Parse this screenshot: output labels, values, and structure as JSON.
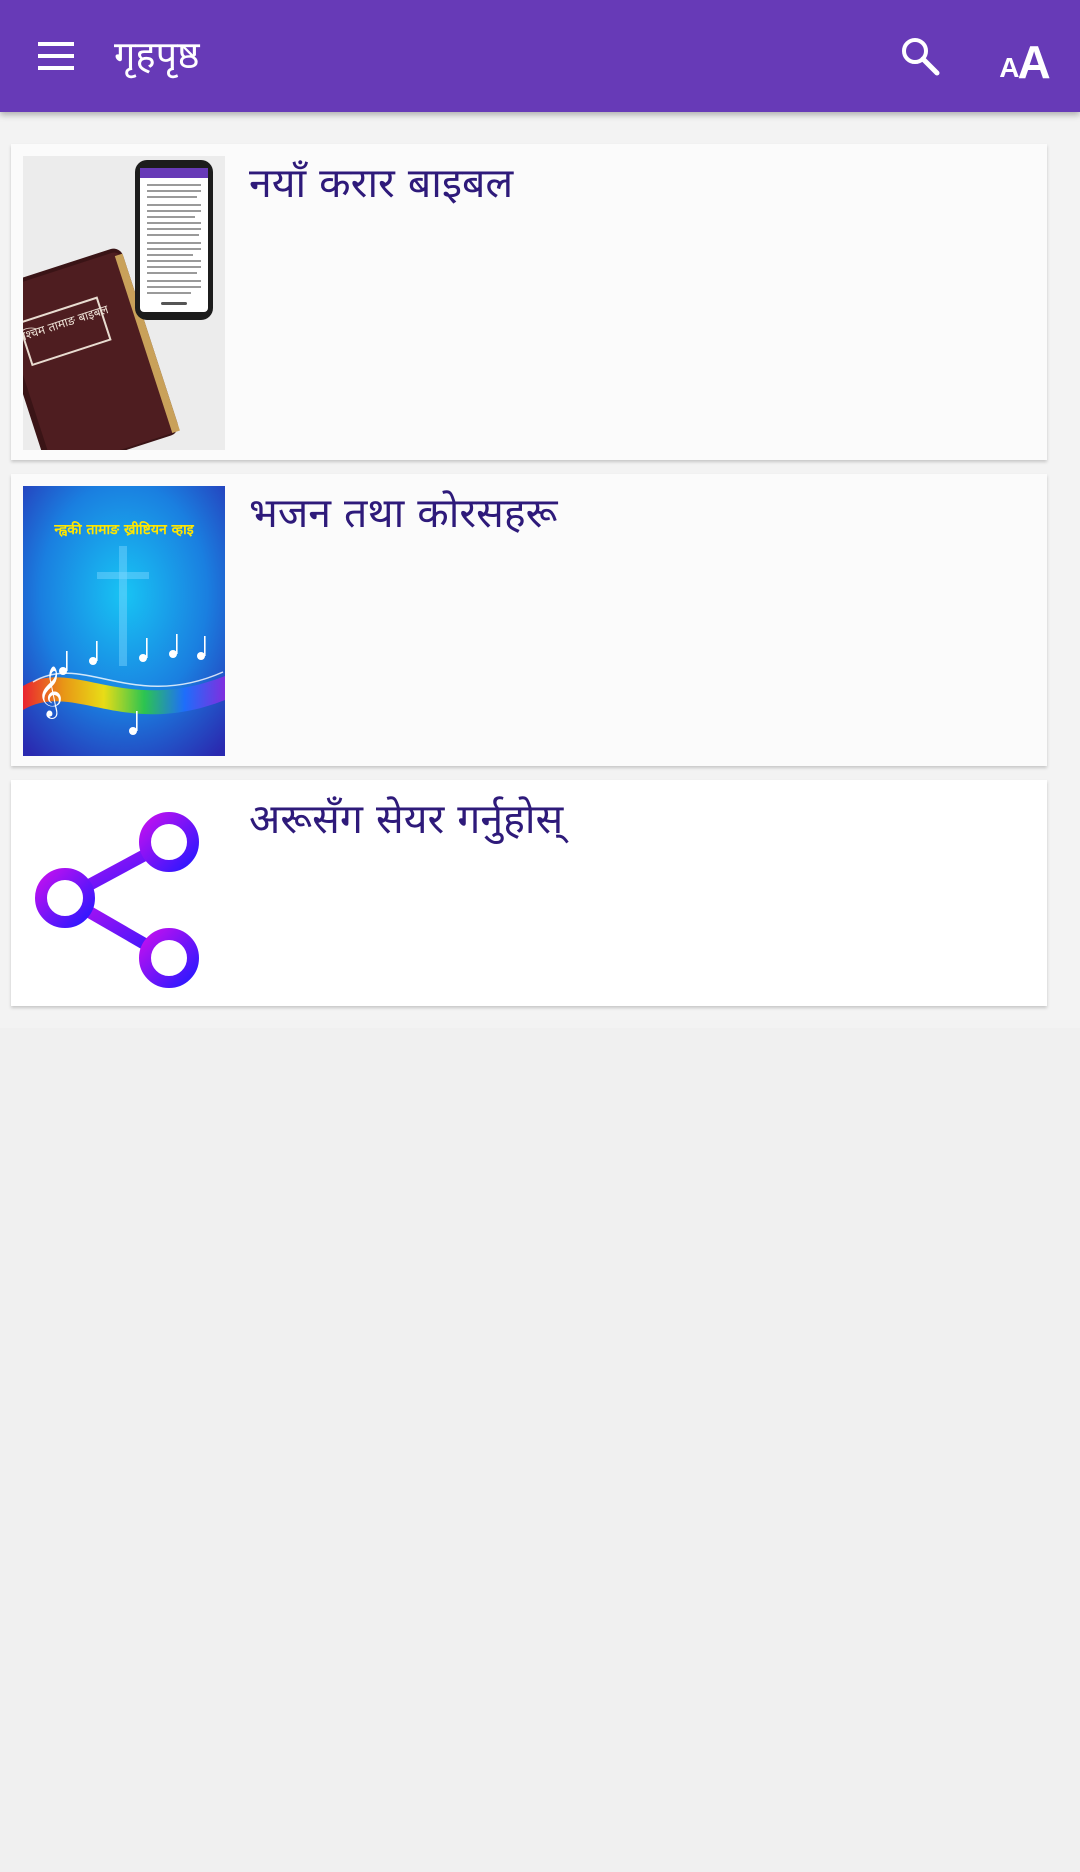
{
  "appbar": {
    "title": "गृहपृष्ठ",
    "menu_icon": "menu-icon",
    "search_icon": "search-icon",
    "font_size_icon": "font-size-icon",
    "font_size_small_glyph": "A",
    "font_size_big_glyph": "A",
    "color": "#673ab7"
  },
  "items": [
    {
      "label": "नयाँ करार बाइबल",
      "thumbnail": "bible-book-and-phone-image",
      "thumbnail_text": "पश्चिम तामाङ बाइबल"
    },
    {
      "label": "भजन तथा कोरसहरू",
      "thumbnail": "hymn-book-cover-image",
      "thumbnail_text": "न्ह्वकी तामाङ ख्रीष्टियन व्हाइ"
    },
    {
      "label": "अरूसँग सेयर गर्नुहोस्",
      "thumbnail": "share-icon"
    }
  ],
  "colors": {
    "label_text": "#2e1a7a",
    "background": "#f0f0f0"
  }
}
